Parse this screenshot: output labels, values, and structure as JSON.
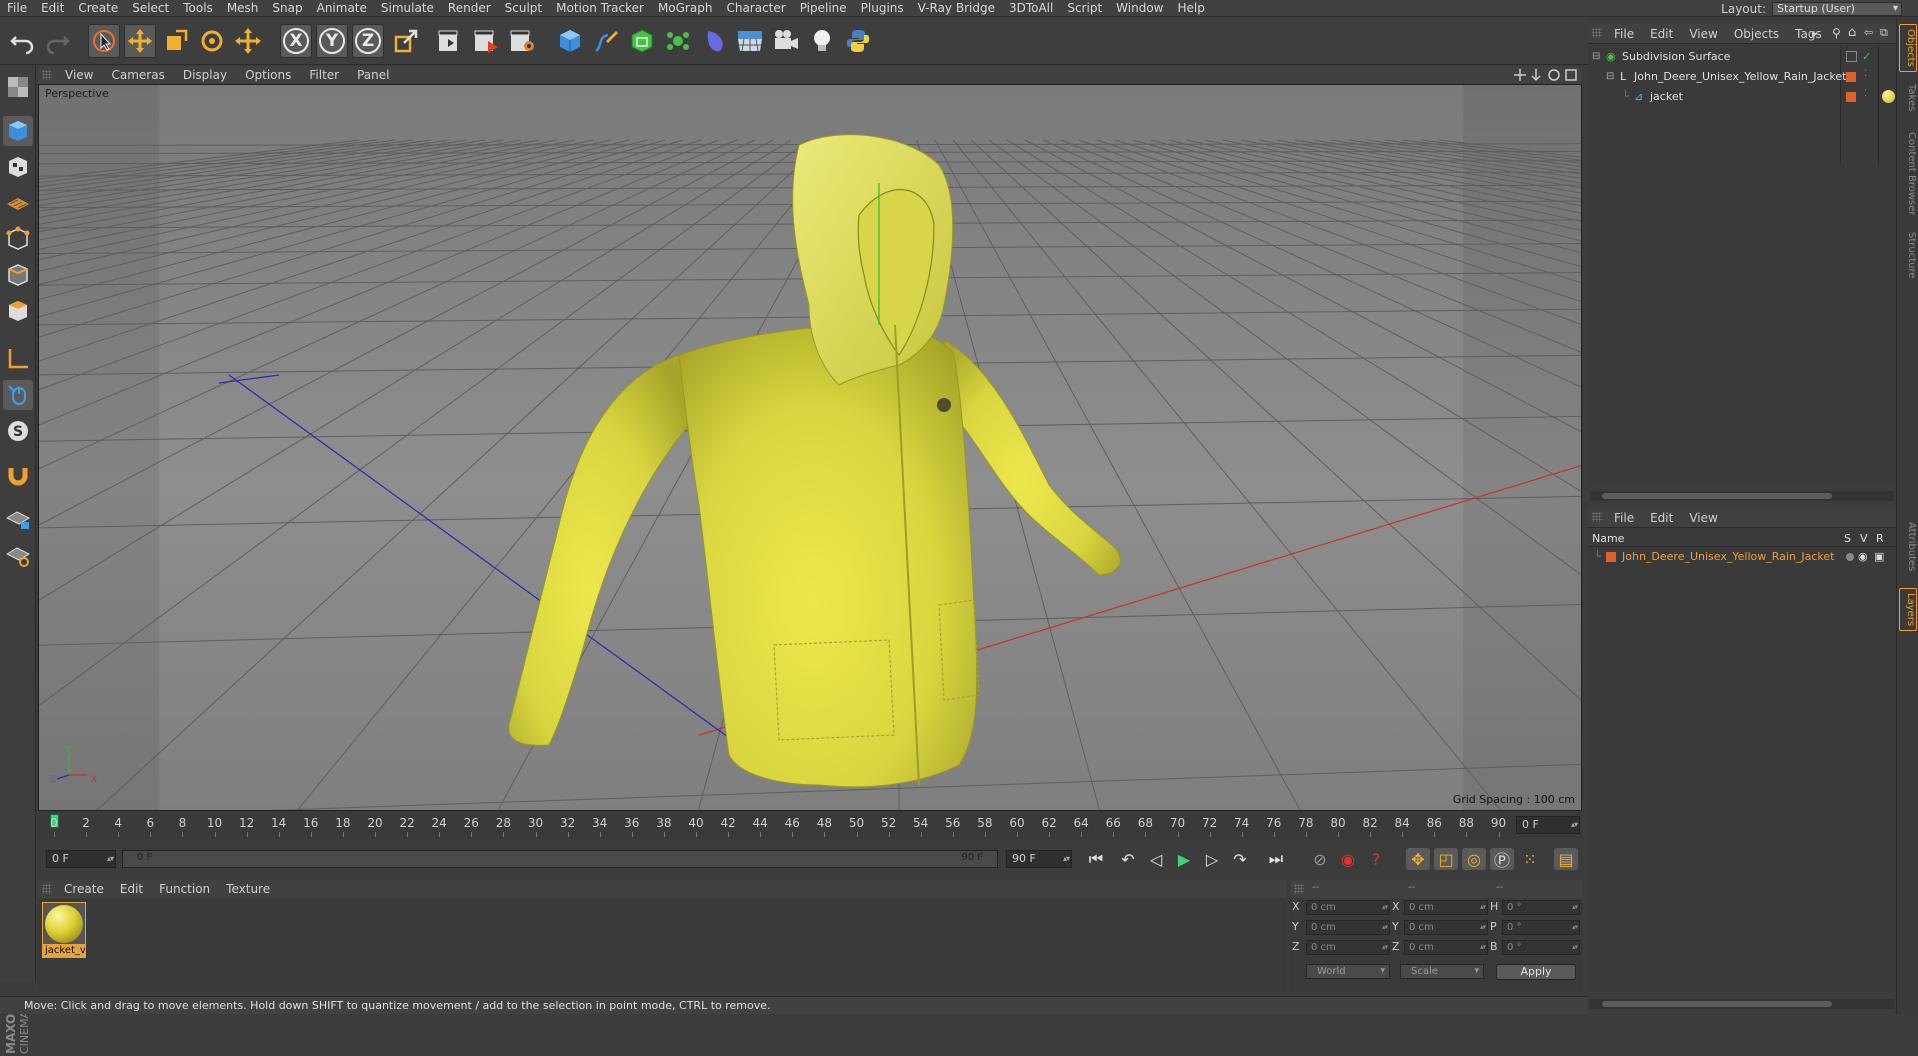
{
  "menu": [
    "File",
    "Edit",
    "Create",
    "Select",
    "Tools",
    "Mesh",
    "Snap",
    "Animate",
    "Simulate",
    "Render",
    "Sculpt",
    "Motion Tracker",
    "MoGraph",
    "Character",
    "Pipeline",
    "Plugins",
    "V-Ray Bridge",
    "3DToAll",
    "Script",
    "Window",
    "Help"
  ],
  "layout": {
    "label": "Layout:",
    "value": "Startup (User)"
  },
  "toolbar": {
    "axis_x": "X",
    "axis_y": "Y",
    "axis_z": "Z"
  },
  "viewport": {
    "menu": [
      "View",
      "Cameras",
      "Display",
      "Options",
      "Filter",
      "Panel"
    ],
    "label": "Perspective",
    "grid_spacing": "Grid Spacing : 100 cm",
    "axis_y": "Y",
    "axis_z": "Z",
    "axis_x": "X"
  },
  "timeline": {
    "ticks": [
      "0",
      "2",
      "4",
      "6",
      "8",
      "10",
      "12",
      "14",
      "16",
      "18",
      "20",
      "22",
      "24",
      "26",
      "28",
      "30",
      "32",
      "34",
      "36",
      "38",
      "40",
      "42",
      "44",
      "46",
      "48",
      "50",
      "52",
      "54",
      "56",
      "58",
      "60",
      "62",
      "64",
      "66",
      "68",
      "70",
      "72",
      "74",
      "76",
      "78",
      "80",
      "82",
      "84",
      "86",
      "88",
      "90"
    ],
    "current_frame": "0 F",
    "start_field": "0 F",
    "range_left": "0 F",
    "range_right": "90 F",
    "end_field": "90 F"
  },
  "materials": {
    "menu": [
      "Create",
      "Edit",
      "Function",
      "Texture"
    ],
    "items": [
      {
        "name": "jacket_v"
      }
    ]
  },
  "coordinates": {
    "header": [
      "--",
      "--",
      "--"
    ],
    "rows": [
      {
        "a": "X",
        "av": "0 cm",
        "b": "X",
        "bv": "0 cm",
        "c": "H",
        "cv": "0 °"
      },
      {
        "a": "Y",
        "av": "0 cm",
        "b": "Y",
        "bv": "0 cm",
        "c": "P",
        "cv": "0 °"
      },
      {
        "a": "Z",
        "av": "0 cm",
        "b": "Z",
        "bv": "0 cm",
        "c": "B",
        "cv": "0 °"
      }
    ],
    "mode": "World",
    "size_mode": "Scale",
    "apply": "Apply"
  },
  "status": "Move: Click and drag to move elements. Hold down SHIFT to quantize movement / add to the selection in point mode, CTRL to remove.",
  "object_manager": {
    "menu": [
      "File",
      "Edit",
      "View",
      "Objects",
      "Tags"
    ],
    "objects": [
      {
        "name": "Subdivision Surface"
      },
      {
        "name": "John_Deere_Unisex_Yellow_Rain_Jacket"
      },
      {
        "name": "jacket"
      }
    ]
  },
  "layers": {
    "menu": [
      "File",
      "Edit",
      "View"
    ],
    "col_name": "Name",
    "col_s": "S",
    "col_v": "V",
    "col_r": "R",
    "items": [
      {
        "name": "John_Deere_Unisex_Yellow_Rain_Jacket"
      }
    ]
  },
  "right_tabs": [
    "Objects",
    "Takes",
    "Content Browser",
    "Structure",
    "Attributes",
    "Layers"
  ],
  "brand": {
    "line1": "MAXON",
    "line2": "CINEMA4D"
  },
  "colors": {
    "accent": "#f0a030",
    "layer_color": "#e0622b",
    "jacket_yellow": "#e4e34a",
    "viewport_bg": "#8c8c8c"
  }
}
